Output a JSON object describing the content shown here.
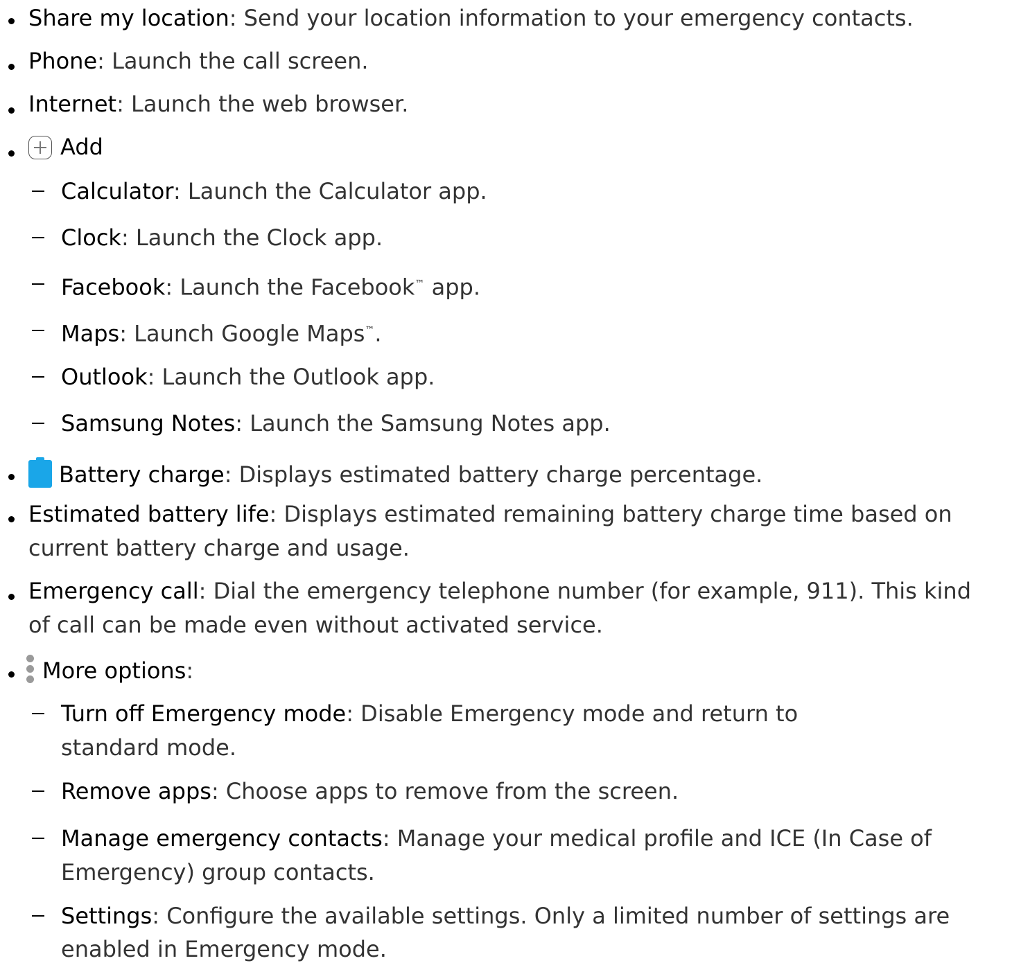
{
  "items": [
    {
      "term": "Share my location",
      "desc": ": Send your location information to your emergency contacts."
    },
    {
      "term": "Phone",
      "desc": ": Launch the call screen."
    },
    {
      "term": "Internet",
      "desc": ": Launch the web browser."
    },
    {
      "icon": "plus-icon",
      "term": "Add",
      "desc": "",
      "sub": [
        {
          "term": "Calculator",
          "desc": ": Launch the Calculator app."
        },
        {
          "term": "Clock",
          "desc": ": Launch the Clock app."
        },
        {
          "term": "Facebook",
          "desc_a": ": Launch the Facebook",
          "tm": "™",
          "desc_b": " app."
        },
        {
          "term": "Maps",
          "desc_a": ": Launch Google Maps",
          "tm": "™",
          "desc_b": "."
        },
        {
          "term": "Outlook",
          "desc": ": Launch the Outlook app."
        },
        {
          "term": "Samsung Notes",
          "desc": ": Launch the Samsung Notes app."
        }
      ]
    },
    {
      "icon": "battery-icon",
      "icon_color": "#1aa6e8",
      "term": "Battery charge",
      "desc": ": Displays estimated battery charge percentage."
    },
    {
      "term": "Estimated battery life",
      "desc": ": Displays estimated remaining battery charge time based on",
      "desc_cont": "current battery charge and usage."
    },
    {
      "term": "Emergency call",
      "desc": ": Dial the emergency telephone number (for example, 911). This kind",
      "desc_cont": "of call can be made even without activated service."
    },
    {
      "icon": "more-options-icon",
      "term": "More options",
      "desc": ":",
      "sub": [
        {
          "term": "Turn off Emergency mode",
          "desc": ": Disable Emergency mode and return to",
          "desc_cont": "standard mode."
        },
        {
          "term": "Remove apps",
          "desc": ": Choose apps to remove from the screen."
        },
        {
          "term": "Manage emergency contacts",
          "desc": ": Manage your medical profile and ICE (In Case of",
          "desc_cont": "Emergency) group contacts."
        },
        {
          "term": "Settings",
          "desc": ": Configure the available settings. Only a limited number of settings are",
          "desc_cont": "enabled in Emergency mode."
        }
      ]
    }
  ]
}
